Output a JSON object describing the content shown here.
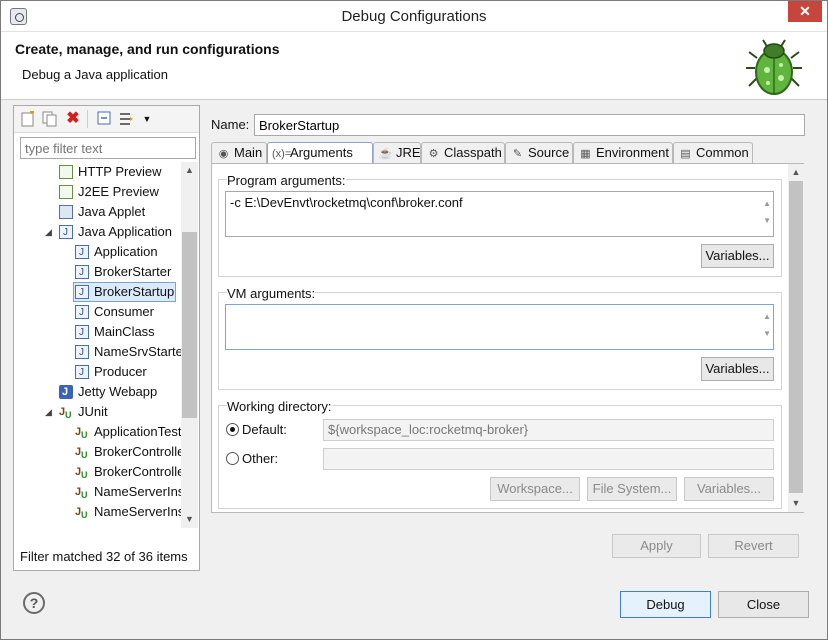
{
  "window": {
    "title": "Debug Configurations",
    "close_glyph": "✕"
  },
  "banner": {
    "heading": "Create, manage, and run configurations",
    "subtitle": "Debug a Java application",
    "icon": "bug-icon"
  },
  "left": {
    "toolbar": {
      "new": "new-config-icon",
      "duplicate": "duplicate-icon",
      "delete": "delete-icon",
      "collapse": "collapse-all-icon",
      "filter": "filter-icon",
      "menu": "view-menu-icon"
    },
    "filter_placeholder": "type filter text",
    "tree": [
      {
        "label": "HTTP Preview",
        "icon": "doc",
        "level": 0,
        "twist": ""
      },
      {
        "label": "J2EE Preview",
        "icon": "doc",
        "level": 0,
        "twist": ""
      },
      {
        "label": "Java Applet",
        "icon": "applet",
        "level": 0,
        "twist": ""
      },
      {
        "label": "Java Application",
        "icon": "java",
        "level": 0,
        "twist": "◢"
      },
      {
        "label": "Application",
        "icon": "java",
        "level": 1,
        "twist": ""
      },
      {
        "label": "BrokerStarter",
        "icon": "java",
        "level": 1,
        "twist": ""
      },
      {
        "label": "BrokerStartup",
        "icon": "java",
        "level": 1,
        "twist": "",
        "selected": true
      },
      {
        "label": "Consumer",
        "icon": "java",
        "level": 1,
        "twist": ""
      },
      {
        "label": "MainClass",
        "icon": "java",
        "level": 1,
        "twist": ""
      },
      {
        "label": "NameSrvStarter",
        "icon": "java",
        "level": 1,
        "twist": ""
      },
      {
        "label": "Producer",
        "icon": "java",
        "level": 1,
        "twist": ""
      },
      {
        "label": "Jetty Webapp",
        "icon": "jetty",
        "level": 0,
        "twist": ""
      },
      {
        "label": "JUnit",
        "icon": "junit",
        "level": 0,
        "twist": "◢"
      },
      {
        "label": "ApplicationTests",
        "icon": "junit",
        "level": 1,
        "twist": ""
      },
      {
        "label": "BrokerController",
        "icon": "junit",
        "level": 1,
        "twist": ""
      },
      {
        "label": "BrokerController",
        "icon": "junit",
        "level": 1,
        "twist": ""
      },
      {
        "label": "NameServerInsta",
        "icon": "junit",
        "level": 1,
        "twist": ""
      },
      {
        "label": "NameServerInsta",
        "icon": "junit",
        "level": 1,
        "twist": ""
      }
    ],
    "status": "Filter matched 32 of 36 items"
  },
  "config": {
    "name_label": "Name:",
    "name_value": "BrokerStartup",
    "tabs": [
      {
        "label": "Main",
        "icon": "main-tab-icon",
        "glyph": "◉"
      },
      {
        "label": "Arguments",
        "icon": "arguments-tab-icon",
        "glyph": "(x)=",
        "active": true
      },
      {
        "label": "JRE",
        "icon": "jre-tab-icon",
        "glyph": "☕"
      },
      {
        "label": "Classpath",
        "icon": "classpath-tab-icon",
        "glyph": "⚙"
      },
      {
        "label": "Source",
        "icon": "source-tab-icon",
        "glyph": "✎"
      },
      {
        "label": "Environment",
        "icon": "environment-tab-icon",
        "glyph": "▦"
      },
      {
        "label": "Common",
        "icon": "common-tab-icon",
        "glyph": "▤"
      }
    ],
    "program_args": {
      "title": "Program arguments:",
      "value": "-c E:\\DevEnvt\\rocketmq\\conf\\broker.conf",
      "variables_label": "Variables..."
    },
    "vm_args": {
      "title": "VM arguments:",
      "value": "",
      "variables_label": "Variables..."
    },
    "working_dir": {
      "title": "Working directory:",
      "default_label": "Default:",
      "default_value": "${workspace_loc:rocketmq-broker}",
      "other_label": "Other:",
      "other_value": "",
      "workspace_label": "Workspace...",
      "filesystem_label": "File System...",
      "variables_label": "Variables..."
    },
    "apply_label": "Apply",
    "revert_label": "Revert"
  },
  "footer": {
    "help_glyph": "?",
    "debug_label": "Debug",
    "close_label": "Close"
  }
}
